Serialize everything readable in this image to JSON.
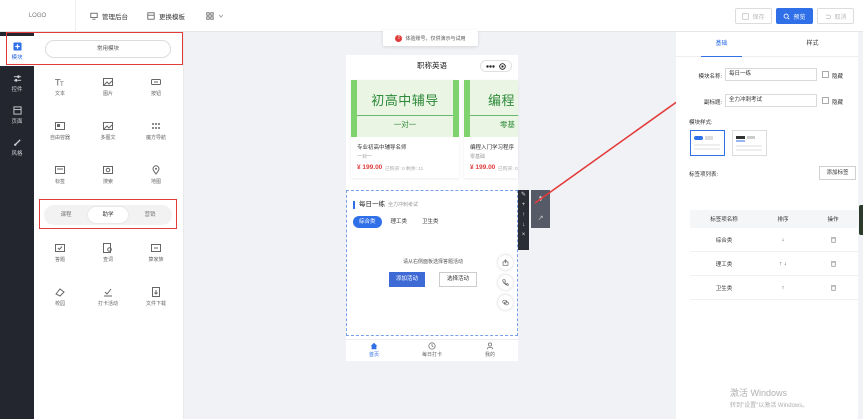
{
  "topbar": {
    "logo": "LOGO",
    "manage_label": "管理后台",
    "template_label": "更换模板",
    "save_label": "保存",
    "preview_label": "预览",
    "withdraw_label": "取消"
  },
  "rail": {
    "items": [
      {
        "label": "模块"
      },
      {
        "label": "控件"
      },
      {
        "label": "页面"
      },
      {
        "label": "风格"
      }
    ]
  },
  "left_panel": {
    "common_label": "常用模块",
    "components_top": [
      {
        "label": "文本"
      },
      {
        "label": "图片"
      },
      {
        "label": "按钮"
      },
      {
        "label": "自由容器"
      },
      {
        "label": "多图文"
      },
      {
        "label": "魔方导航"
      },
      {
        "label": "标签"
      },
      {
        "label": "搜索"
      },
      {
        "label": "地图"
      }
    ],
    "segment": [
      {
        "label": "课程"
      },
      {
        "label": "助学"
      },
      {
        "label": "营销"
      }
    ],
    "components_bottom": [
      {
        "label": "答题"
      },
      {
        "label": "查词"
      },
      {
        "label": "算家族"
      },
      {
        "label": "校园"
      },
      {
        "label": "打卡活动"
      },
      {
        "label": "文件下载"
      }
    ]
  },
  "notice": {
    "text": "体验账号，仅供演示与试用"
  },
  "phone": {
    "title": "职称英语",
    "cards": [
      {
        "banner_main": "初高中辅导",
        "banner_sub": "一对一",
        "name": "专业初高中辅导名师",
        "sub": "一对一",
        "price": "¥ 199.00",
        "sold": "已购买: 0  剩余: 11"
      },
      {
        "banner_main": "编程",
        "banner_sub": "零基",
        "name": "编程入门学习程序",
        "sub": "零基础",
        "price": "¥ 199.00",
        "sold": "已购买: 0"
      }
    ],
    "module": {
      "title": "每日一练",
      "subtitle": "全力冲刺考试",
      "tags": [
        {
          "label": "综合类"
        },
        {
          "label": "理工类"
        },
        {
          "label": "卫生类"
        }
      ],
      "empty_tip": "请从右侧面板选择答题活动",
      "add_button": "添加活动",
      "pick_button": "选择活动"
    },
    "tabbar": [
      {
        "label": "首页"
      },
      {
        "label": "每日打卡"
      },
      {
        "label": "我的"
      }
    ]
  },
  "toolbar_icons": {
    "edit": "✎",
    "add": "+",
    "up": "↑",
    "down": "↓",
    "close": "×"
  },
  "right_panel": {
    "tabs": [
      {
        "label": "基础"
      },
      {
        "label": "样式"
      }
    ],
    "name_label": "模块名称:",
    "name_value": "每日一练",
    "subtitle_label": "副标题:",
    "subtitle_value": "全力冲刺考试",
    "hide_label": "隐藏",
    "style_label": "模块样式:",
    "tag_list_label": "标签项列表:",
    "add_tag_button": "添加标签",
    "table": {
      "headers": [
        "标签项名称",
        "排序",
        "操作"
      ],
      "rows": [
        {
          "name": "综合类",
          "sort": "↓"
        },
        {
          "name": "理工类",
          "sort": "↑ ↓"
        },
        {
          "name": "卫生类",
          "sort": "↑"
        }
      ]
    }
  },
  "watermark": {
    "line1": "激活 Windows",
    "line2": "转到\"设置\"以激活 Windows。"
  },
  "colors": {
    "accent": "#2f6fe8",
    "alert_red": "#e23b3b",
    "banner_green": "#7ed36f",
    "rail_dark": "#23262e"
  }
}
